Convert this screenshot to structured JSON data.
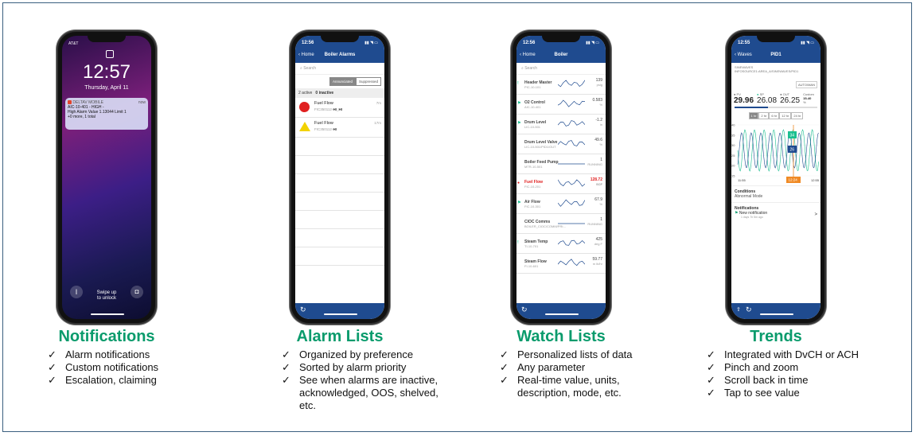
{
  "colors": {
    "accent": "#0a9b6c",
    "appbar": "#1f4b8f",
    "frame": "#3a5f7f",
    "alarm_red": "#e02020",
    "warn_yellow": "#f2d200",
    "wave_green": "#1bbf90",
    "wave_blue": "#1f4b8f"
  },
  "check_glyph": "✓",
  "lock": {
    "carrier": "AT&T",
    "time": "12:57",
    "date": "Thursday, April 11",
    "notif_app": "DELTAV MOBILE",
    "notif_when": "now",
    "notif_line1": "AIC-10-401 - HIGH -",
    "notif_line2": "High Alarm Value 1.13044 Limit 1",
    "notif_line3": "+0 more, 1 total",
    "swipe1": "Swipe up",
    "swipe2": "to unlock",
    "flashlight_icon": "flashlight-icon",
    "camera_icon": "camera-icon"
  },
  "alarms_screen": {
    "time": "12:56",
    "back": "Home",
    "title": "Boiler Alarms",
    "search": "Search",
    "seg_a": "Annunciated",
    "seg_b": "Suppressed",
    "counts_active": "2 active",
    "counts_inactive": "0 inactive",
    "rows": [
      {
        "name": "Fuel Flow",
        "tag": "FIC350112-",
        "level": "HI_HI",
        "age": "7m"
      },
      {
        "name": "Fuel Flow",
        "tag": "FIC350112-",
        "level": "HI",
        "age": "17m"
      }
    ]
  },
  "watch_screen": {
    "time": "12:56",
    "back": "Home",
    "title": "Boiler",
    "search": "Search",
    "rows": [
      {
        "name": "Header Master",
        "tag": "PIC-10-101",
        "val": "139",
        "unit": "psig"
      },
      {
        "name": "O2 Control",
        "tag": "AIC-10-401",
        "val": "0.583",
        "unit": "%"
      },
      {
        "name": "Drum Level",
        "tag": "LIC-10-501",
        "val": "-1.2",
        "unit": "in"
      },
      {
        "name": "Drum Level Valve",
        "tag": "LIC-10-501/PID1/OUT",
        "val": "49.6",
        "unit": "%"
      },
      {
        "name": "Boiler Feed Pump",
        "tag": "MTR-10-501",
        "val": "1",
        "unit": "RUNNING"
      },
      {
        "name": "Fuel Flow",
        "tag": "FIC-10-201",
        "val": "128.72",
        "unit": "SCF"
      },
      {
        "name": "Air Flow",
        "tag": "FIC-10-301",
        "val": "67.9",
        "unit": "%"
      },
      {
        "name": "CIOC Comms",
        "tag": "BOILER_CIOC/COMM/PRI...",
        "val": "1",
        "unit": "RUNNING"
      },
      {
        "name": "Steam Temp",
        "tag": "TI-10-701",
        "val": "425",
        "unit": "deg F"
      },
      {
        "name": "Steam Flow",
        "tag": "FI-10-601",
        "val": "59.77",
        "unit": "m lb/hr"
      }
    ]
  },
  "trend_screen": {
    "time": "12:55",
    "back": "Waves",
    "title": "PID1",
    "path1": "SINEWAVES",
    "path2": "INFOSOURCE1:AREA_A/SINEWAVES/PID1",
    "mode": "AUTO/MAN",
    "pv_label": "PV",
    "pv": "29.96",
    "sp_label": "SP",
    "sp": "26.08",
    "out_label": "OUT",
    "out": "26.25",
    "custom_label": "Custom",
    "custom": "15-40",
    "custom_unit": "%",
    "ranges": [
      "1 hr",
      "2 hr",
      "6 hr",
      "12 hr",
      "24 hr"
    ],
    "y_ticks": [
      "40",
      "35",
      "30",
      "25",
      "20",
      "15"
    ],
    "x_left": "11:55",
    "x_right": "12:55",
    "cursor_time": "12:24",
    "cursor_val1": "34",
    "cursor_val2": "26",
    "cond_title": "Conditions",
    "cond_val": "Abnormal Mode",
    "notif_title": "Notifications",
    "notif_item": "New notification",
    "notif_age": "1 days 7h 5m ago"
  },
  "sections": [
    {
      "title": "Notifications",
      "bullets": [
        "Alarm notifications",
        "Custom notifications",
        "Escalation, claiming"
      ]
    },
    {
      "title": "Alarm Lists",
      "bullets": [
        "Organized by preference",
        "Sorted by alarm priority",
        "See when alarms are inactive, acknowledged, OOS, shelved, etc."
      ]
    },
    {
      "title": "Watch Lists",
      "bullets": [
        "Personalized lists of data",
        "Any parameter",
        "Real-time value, units, description, mode, etc."
      ]
    },
    {
      "title": "Trends",
      "bullets": [
        "Integrated with DvCH or ACH",
        "Pinch and zoom",
        "Scroll back in time",
        "Tap to see value"
      ]
    }
  ]
}
